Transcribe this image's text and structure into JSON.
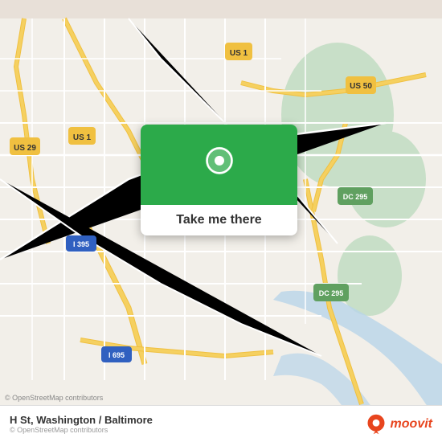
{
  "map": {
    "attribution": "© OpenStreetMap contributors",
    "background_color": "#f2efe9",
    "road_color_highway": "#f5d76e",
    "road_color_street": "#ffffff",
    "road_color_route": "#e8c84a",
    "park_color": "#c8dfc8",
    "water_color": "#b0d0e8"
  },
  "card": {
    "button_label": "Take me there",
    "pin_color": "#2caa4a"
  },
  "info_bar": {
    "location": "H St, Washington / Baltimore",
    "attribution": "© OpenStreetMap contributors"
  },
  "moovit": {
    "label": "moovit",
    "icon_color": "#e8451e"
  }
}
